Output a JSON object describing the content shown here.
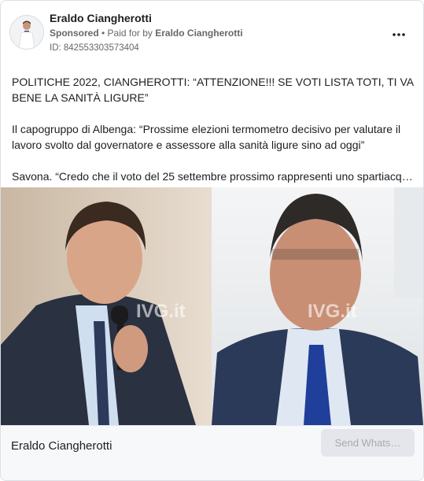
{
  "ad": {
    "page_name": "Eraldo Ciangherotti",
    "sponsored_label": "Sponsored",
    "separator": " • ",
    "paid_for_prefix": "Paid for by ",
    "paid_for_name": "Eraldo Ciangherotti",
    "ad_id": "ID: 842553303573404",
    "more_icon": "more-horizontal-icon"
  },
  "post": {
    "paragraph1": "POLITICHE 2022, CIANGHEROTTI: “ATTENZIONE!!! SE VOTI LISTA TOTI, TI VA BENE LA SANITÀ LIGURE”",
    "paragraph2": "Il capogruppo di Albenga: “Prossime elezioni termometro decisivo per valutare il lavoro svolto dal governatore e assessore alla sanità ligure sino ad oggi”",
    "paragraph3": "Savona. “Credo che il voto del 25 settembre prossimo rappresenti uno spartiacque…"
  },
  "media": {
    "watermark_left": "IVG.it",
    "watermark_right": "IVG.it"
  },
  "footer": {
    "name": "Eraldo Ciangherotti",
    "cta_label": "Send Whats…"
  }
}
